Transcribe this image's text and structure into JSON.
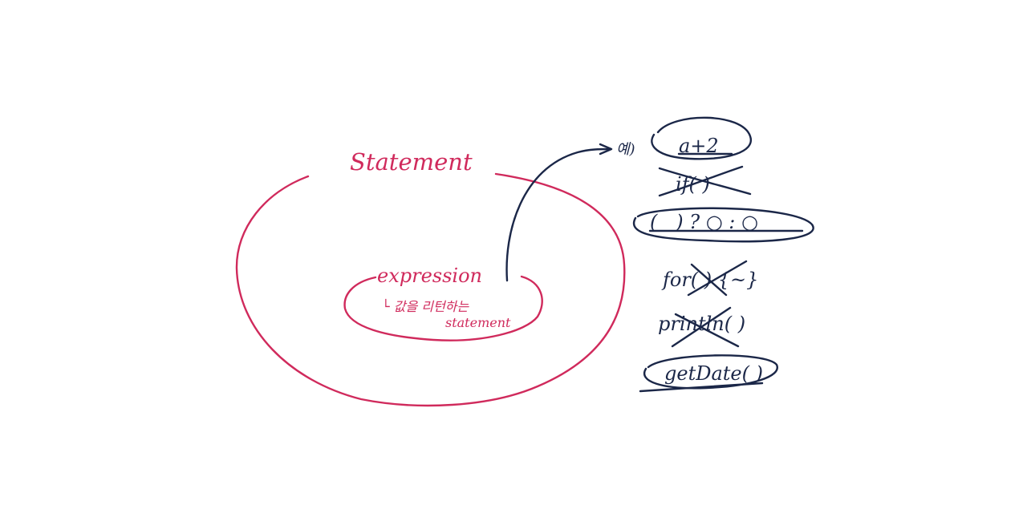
{
  "diagram": {
    "outer_label": "Statement",
    "inner_label": "expression",
    "inner_note_line1": "└ 값을 리턴하는",
    "inner_note_line2": "statement",
    "example_marker": "예)",
    "items": [
      {
        "text": "a+2",
        "status": "circled"
      },
      {
        "text": "if( )",
        "status": "crossed"
      },
      {
        "text": "(   ) ? ○ : ○",
        "status": "circled"
      },
      {
        "text": "for( ) {~}",
        "status": "crossed"
      },
      {
        "text": "println( )",
        "status": "crossed"
      },
      {
        "text": "getDate( )",
        "status": "circled"
      }
    ],
    "colors": {
      "outer": "#d02a5c",
      "examples": "#1b2748",
      "background": "#ffffff"
    }
  }
}
